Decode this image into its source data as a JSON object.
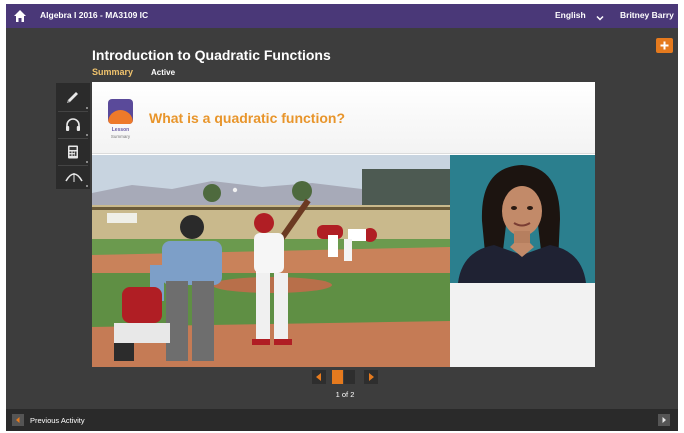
{
  "topbar": {
    "course_title": "Algebra I 2016 - MA3109 IC",
    "language": "English",
    "user_name": "Britney Barry"
  },
  "header": {
    "page_title": "Introduction to Quadratic Functions",
    "tabs": [
      {
        "label": "Summary",
        "selected": true
      },
      {
        "label": "Active",
        "selected": false
      }
    ]
  },
  "tools": {
    "items": [
      "pencil-icon",
      "headphones-icon",
      "calculator-icon",
      "graph-icon"
    ]
  },
  "slide": {
    "lesson_label": "Lesson",
    "summary_label": "Summary",
    "question": "What is a quadratic function?"
  },
  "pager": {
    "current_page": 1,
    "total_pages": 2,
    "page_count_text": "1 of 2"
  },
  "footer": {
    "prev_label": "Previous Activity"
  },
  "colors": {
    "topbar": "#4a3878",
    "accent": "#e57a1e",
    "question": "#e8952b",
    "summary_tab": "#f0c36d",
    "background": "#3d3d3d"
  }
}
